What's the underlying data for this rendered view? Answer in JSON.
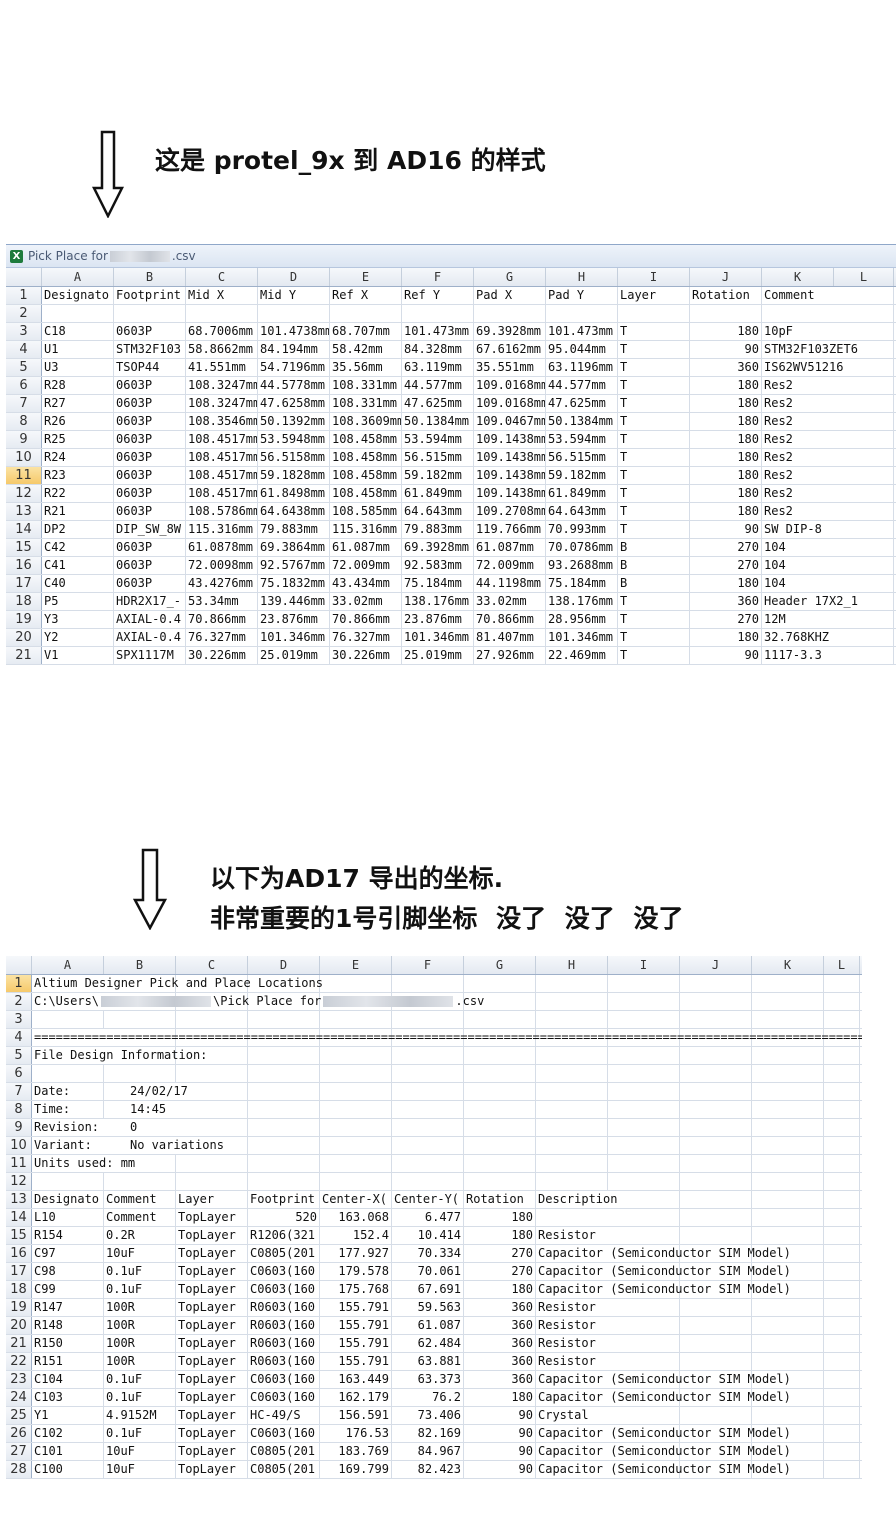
{
  "heading1": "这是 protel_9x 到 AD16 的样式",
  "heading2_line1": "以下为AD17 导出的坐标.",
  "heading2_line2": "非常重要的1号引脚坐标 没了 没了 没了",
  "sheet1": {
    "title_prefix": "Pick Place for",
    "title_suffix": ".csv",
    "columns": [
      "A",
      "B",
      "C",
      "D",
      "E",
      "F",
      "G",
      "H",
      "I",
      "J",
      "K",
      "L"
    ],
    "selected_row": "11",
    "rows": [
      [
        "1",
        "Designato",
        "Footprint",
        "Mid X",
        "Mid Y",
        "Ref X",
        "Ref Y",
        "Pad X",
        "Pad Y",
        "Layer",
        "Rotation",
        "Comment",
        ""
      ],
      [
        "2",
        "",
        "",
        "",
        "",
        "",
        "",
        "",
        "",
        "",
        "",
        "",
        ""
      ],
      [
        "3",
        "C18",
        "0603P",
        "68.7006mm",
        "101.4738mm",
        "68.707mm",
        "101.473mm",
        "69.3928mm",
        "101.473mm",
        "T",
        "180",
        "10pF",
        ""
      ],
      [
        "4",
        "U1",
        "STM32F103",
        "58.8662mm",
        "84.194mm",
        "58.42mm",
        "84.328mm",
        "67.6162mm",
        "95.044mm",
        "T",
        "90",
        "STM32F103ZET6",
        ""
      ],
      [
        "5",
        "U3",
        "TSOP44",
        "41.551mm",
        "54.7196mm",
        "35.56mm",
        "63.119mm",
        "35.551mm",
        "63.1196mm",
        "T",
        "360",
        "IS62WV51216",
        ""
      ],
      [
        "6",
        "R28",
        "0603P",
        "108.3247mm",
        "44.5778mm",
        "108.331mm",
        "44.577mm",
        "109.0168mm",
        "44.577mm",
        "T",
        "180",
        "Res2",
        ""
      ],
      [
        "7",
        "R27",
        "0603P",
        "108.3247mm",
        "47.6258mm",
        "108.331mm",
        "47.625mm",
        "109.0168mm",
        "47.625mm",
        "T",
        "180",
        "Res2",
        ""
      ],
      [
        "8",
        "R26",
        "0603P",
        "108.3546mm",
        "50.1392mm",
        "108.3609mm",
        "50.1384mm",
        "109.0467mm",
        "50.1384mm",
        "T",
        "180",
        "Res2",
        ""
      ],
      [
        "9",
        "R25",
        "0603P",
        "108.4517mm",
        "53.5948mm",
        "108.458mm",
        "53.594mm",
        "109.1438mm",
        "53.594mm",
        "T",
        "180",
        "Res2",
        ""
      ],
      [
        "10",
        "R24",
        "0603P",
        "108.4517mm",
        "56.5158mm",
        "108.458mm",
        "56.515mm",
        "109.1438mm",
        "56.515mm",
        "T",
        "180",
        "Res2",
        ""
      ],
      [
        "11",
        "R23",
        "0603P",
        "108.4517mm",
        "59.1828mm",
        "108.458mm",
        "59.182mm",
        "109.1438mm",
        "59.182mm",
        "T",
        "180",
        "Res2",
        ""
      ],
      [
        "12",
        "R22",
        "0603P",
        "108.4517mm",
        "61.8498mm",
        "108.458mm",
        "61.849mm",
        "109.1438mm",
        "61.849mm",
        "T",
        "180",
        "Res2",
        ""
      ],
      [
        "13",
        "R21",
        "0603P",
        "108.5786mm",
        "64.6438mm",
        "108.585mm",
        "64.643mm",
        "109.2708mm",
        "64.643mm",
        "T",
        "180",
        "Res2",
        ""
      ],
      [
        "14",
        "DP2",
        "DIP_SW_8W",
        "115.316mm",
        "79.883mm",
        "115.316mm",
        "79.883mm",
        "119.766mm",
        "70.993mm",
        "T",
        "90",
        "SW DIP-8",
        ""
      ],
      [
        "15",
        "C42",
        "0603P",
        "61.0878mm",
        "69.3864mm",
        "61.087mm",
        "69.3928mm",
        "61.087mm",
        "70.0786mm",
        "B",
        "270",
        "104",
        ""
      ],
      [
        "16",
        "C41",
        "0603P",
        "72.0098mm",
        "92.5767mm",
        "72.009mm",
        "92.583mm",
        "72.009mm",
        "93.2688mm",
        "B",
        "270",
        "104",
        ""
      ],
      [
        "17",
        "C40",
        "0603P",
        "43.4276mm",
        "75.1832mm",
        "43.434mm",
        "75.184mm",
        "44.1198mm",
        "75.184mm",
        "B",
        "180",
        "104",
        ""
      ],
      [
        "18",
        "P5",
        "HDR2X17_-",
        "53.34mm",
        "139.446mm",
        "33.02mm",
        "138.176mm",
        "33.02mm",
        "138.176mm",
        "T",
        "360",
        "Header 17X2_1",
        ""
      ],
      [
        "19",
        "Y3",
        "AXIAL-0.4",
        "70.866mm",
        "23.876mm",
        "70.866mm",
        "23.876mm",
        "70.866mm",
        "28.956mm",
        "T",
        "270",
        "12M",
        ""
      ],
      [
        "20",
        "Y2",
        "AXIAL-0.4",
        "76.327mm",
        "101.346mm",
        "76.327mm",
        "101.346mm",
        "81.407mm",
        "101.346mm",
        "T",
        "180",
        "32.768KHZ",
        ""
      ],
      [
        "21",
        "V1",
        "SPX1117M",
        "30.226mm",
        "25.019mm",
        "30.226mm",
        "25.019mm",
        "27.926mm",
        "22.469mm",
        "T",
        "90",
        "1117-3.3",
        ""
      ]
    ]
  },
  "sheet2": {
    "columns": [
      "A",
      "B",
      "C",
      "D",
      "E",
      "F",
      "G",
      "H",
      "I",
      "J",
      "K",
      "L"
    ],
    "selected_row": "1",
    "title_row": "Altium Designer Pick and Place Locations",
    "path_prefix": "C:\\Users\\",
    "path_mid": "\\Pick Place for",
    "path_suffix": ".csv",
    "separator": "========================================================================================================================",
    "design_info": "File Design Information:",
    "date_label": "Date:",
    "date_value": "24/02/17",
    "time_label": "Time:",
    "time_value": "14:45",
    "revision_label": "Revision:",
    "revision_value": "0",
    "variant_label": "Variant:",
    "variant_value": "No variations",
    "units": "Units used: mm",
    "header": [
      "Designato",
      "Comment",
      "Layer",
      "Footprint",
      "Center-X(",
      "Center-Y(",
      "Rotation",
      "Description"
    ],
    "rows": [
      [
        "14",
        "L10",
        "Comment",
        "TopLayer",
        "520",
        "163.068",
        "6.477",
        "180",
        ""
      ],
      [
        "15",
        "R154",
        "0.2R",
        "TopLayer",
        "R1206(321",
        "152.4",
        "10.414",
        "180",
        "Resistor"
      ],
      [
        "16",
        "C97",
        "10uF",
        "TopLayer",
        "C0805(201",
        "177.927",
        "70.334",
        "270",
        "Capacitor (Semiconductor SIM Model)"
      ],
      [
        "17",
        "C98",
        "0.1uF",
        "TopLayer",
        "C0603(160",
        "179.578",
        "70.061",
        "270",
        "Capacitor (Semiconductor SIM Model)"
      ],
      [
        "18",
        "C99",
        "0.1uF",
        "TopLayer",
        "C0603(160",
        "175.768",
        "67.691",
        "180",
        "Capacitor (Semiconductor SIM Model)"
      ],
      [
        "19",
        "R147",
        "100R",
        "TopLayer",
        "R0603(160",
        "155.791",
        "59.563",
        "360",
        "Resistor"
      ],
      [
        "20",
        "R148",
        "100R",
        "TopLayer",
        "R0603(160",
        "155.791",
        "61.087",
        "360",
        "Resistor"
      ],
      [
        "21",
        "R150",
        "100R",
        "TopLayer",
        "R0603(160",
        "155.791",
        "62.484",
        "360",
        "Resistor"
      ],
      [
        "22",
        "R151",
        "100R",
        "TopLayer",
        "R0603(160",
        "155.791",
        "63.881",
        "360",
        "Resistor"
      ],
      [
        "23",
        "C104",
        "0.1uF",
        "TopLayer",
        "C0603(160",
        "163.449",
        "63.373",
        "360",
        "Capacitor (Semiconductor SIM Model)"
      ],
      [
        "24",
        "C103",
        "0.1uF",
        "TopLayer",
        "C0603(160",
        "162.179",
        "76.2",
        "180",
        "Capacitor (Semiconductor SIM Model)"
      ],
      [
        "25",
        "Y1",
        "4.9152M",
        "TopLayer",
        "HC-49/S",
        "156.591",
        "73.406",
        "90",
        "Crystal"
      ],
      [
        "26",
        "C102",
        "0.1uF",
        "TopLayer",
        "C0603(160",
        "176.53",
        "82.169",
        "90",
        "Capacitor (Semiconductor SIM Model)"
      ],
      [
        "27",
        "C101",
        "10uF",
        "TopLayer",
        "C0805(201",
        "183.769",
        "84.967",
        "90",
        "Capacitor (Semiconductor SIM Model)"
      ],
      [
        "28",
        "C100",
        "10uF",
        "TopLayer",
        "C0805(201",
        "169.799",
        "82.423",
        "90",
        "Capacitor (Semiconductor SIM Model)"
      ]
    ]
  }
}
